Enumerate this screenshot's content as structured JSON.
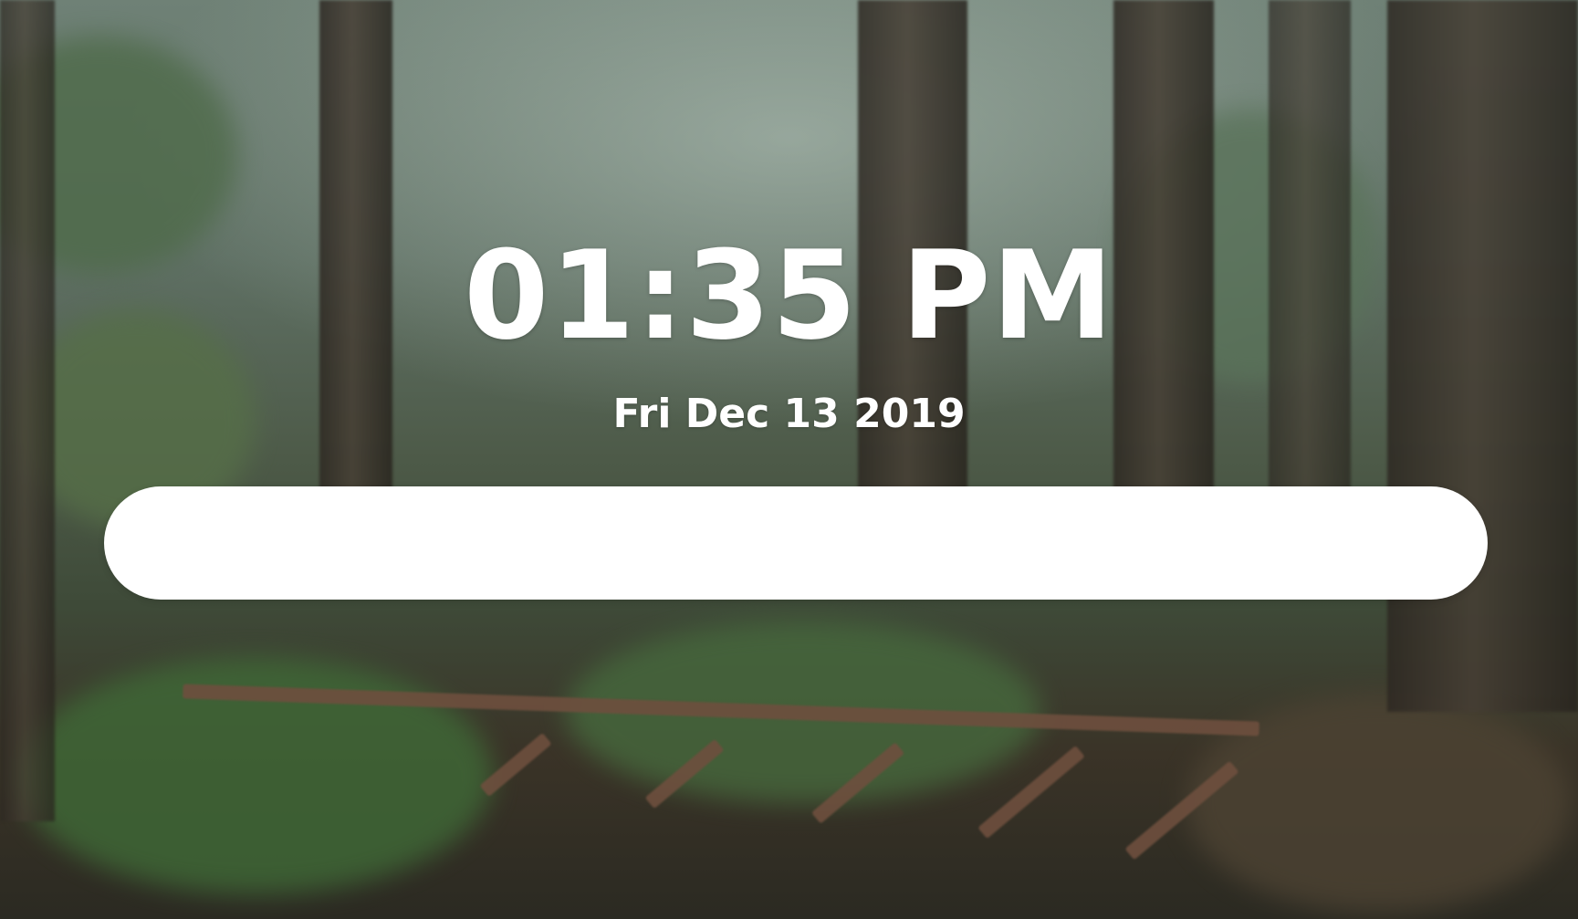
{
  "clock": {
    "time": "01:35 PM",
    "date": "Fri Dec 13 2019"
  },
  "search": {
    "value": "",
    "placeholder": ""
  },
  "background": {
    "description_icon": "forest-stairs-photo"
  }
}
